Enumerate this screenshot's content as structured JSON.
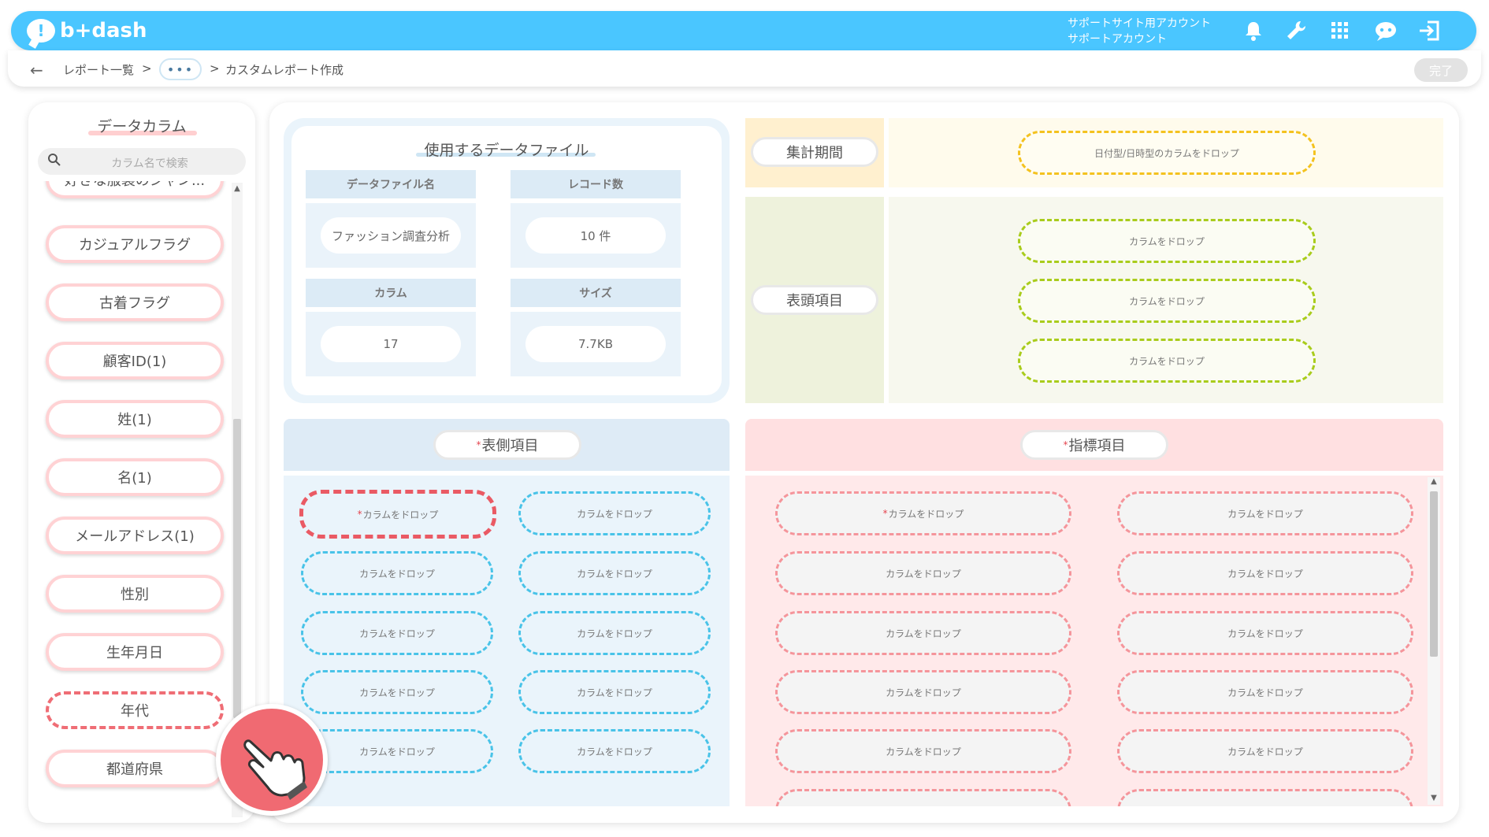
{
  "header": {
    "logo_text": "b+dash",
    "account_line1": "サポートサイト用アカウント",
    "account_line2": "サポートアカウント",
    "icons": [
      "bell-icon",
      "wrench-icon",
      "grid-icon",
      "chat-bot-icon",
      "logout-icon"
    ],
    "color": "#4ac6ff"
  },
  "breadcrumb": {
    "back_icon": "←",
    "item1": "レポート一覧",
    "sep1": ">",
    "ellipsis": "•••",
    "sep2": ">",
    "current": "カスタムレポート作成"
  },
  "done_label": "完了",
  "sidebar": {
    "title": "データカラム",
    "search_placeholder": "カラム名で検索",
    "items": [
      "好きな服装のジャン...",
      "カジュアルフラグ",
      "古着フラグ",
      "顧客ID(1)",
      "姓(1)",
      "名(1)",
      "メールアドレス(1)",
      "性別",
      "生年月日",
      "年代",
      "都道府県"
    ],
    "selected_item": "年代"
  },
  "data_file": {
    "title": "使用するデータファイル",
    "name_label": "データファイル名",
    "name_value": "ファッション調査分析",
    "records_label": "レコード数",
    "records_value": "10 件",
    "columns_label": "カラム",
    "columns_value": "17",
    "size_label": "サイズ",
    "size_value": "7.7KB"
  },
  "period": {
    "label": "集計期間",
    "drop_text": "日付型/日時型のカラムをドロップ"
  },
  "header_items": {
    "label": "表頭項目",
    "drop_text": "カラムをドロップ"
  },
  "side_items": {
    "label": "表側項目",
    "required_mark": "*",
    "drop_text": "カラムをドロップ"
  },
  "metrics": {
    "label": "指標項目",
    "required_mark": "*",
    "drop_text": "カラムをドロップ"
  }
}
